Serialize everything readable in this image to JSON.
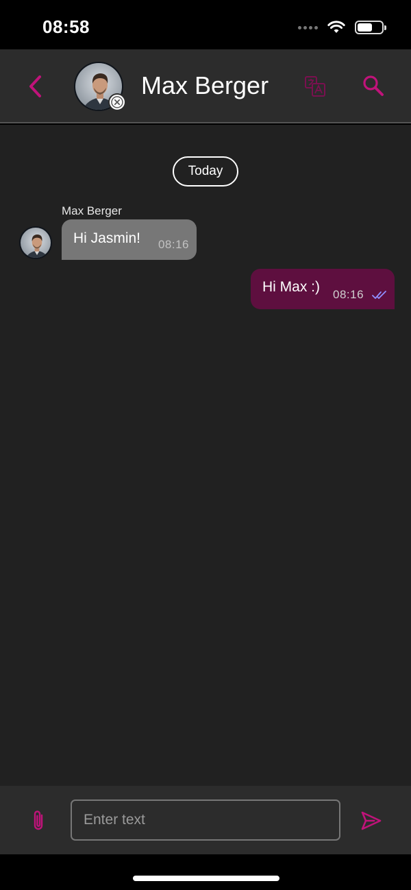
{
  "status_bar": {
    "time": "08:58",
    "icons": [
      "cellular-dots-icon",
      "wifi-icon",
      "battery-icon"
    ]
  },
  "header": {
    "contact_name": "Max Berger",
    "back_icon": "chevron-left-icon",
    "presence_icon": "offline-x-icon",
    "translate_icon": "translate-icon",
    "search_icon": "search-icon"
  },
  "chat": {
    "day_separator": "Today",
    "messages": [
      {
        "direction": "incoming",
        "sender": "Max Berger",
        "text": "Hi Jasmin!",
        "time": "08:16"
      },
      {
        "direction": "outgoing",
        "text": "Hi Max :)",
        "time": "08:16",
        "status_icon": "double-check-icon"
      }
    ]
  },
  "composer": {
    "placeholder": "Enter text",
    "value": "",
    "attach_icon": "paperclip-icon",
    "send_icon": "send-icon"
  },
  "colors": {
    "accent": "#c0137a",
    "header_bg": "#2c2c2c",
    "chat_bg": "#212121",
    "incoming_bubble": "#777777",
    "outgoing_bubble": "#5e0f3f",
    "read_ticks": "#8f8fff"
  }
}
